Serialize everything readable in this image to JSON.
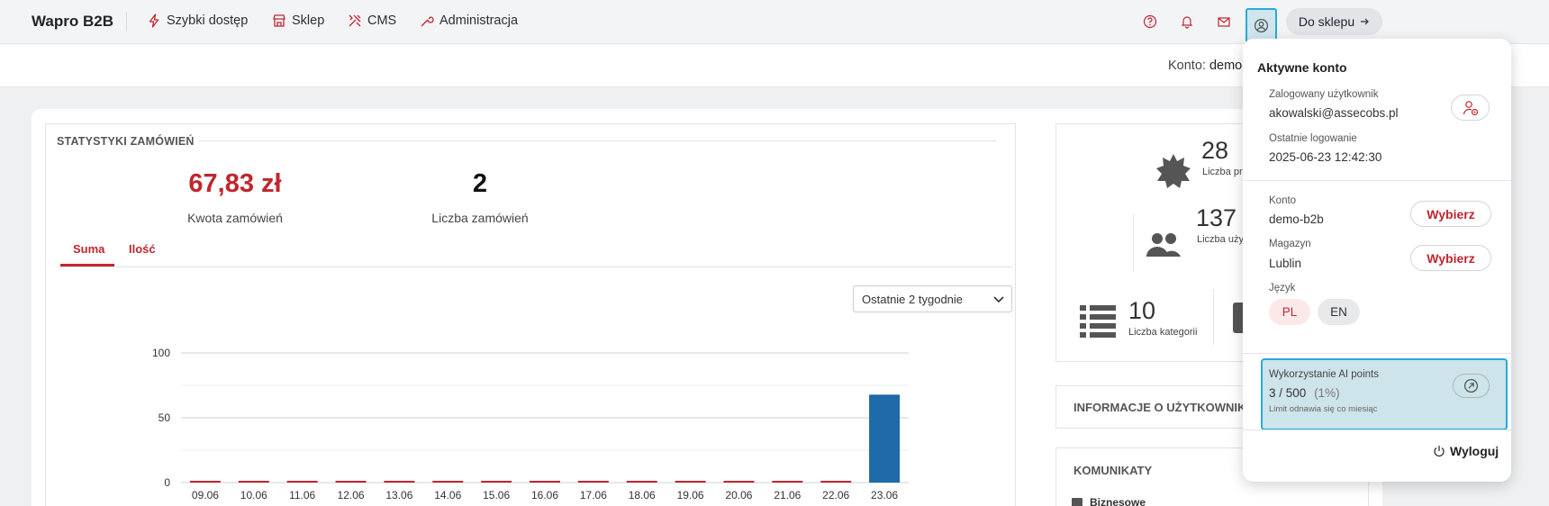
{
  "topbar": {
    "brand": "Wapro B2B",
    "nav": [
      {
        "label": "Szybki dostęp",
        "icon": "lightning-icon"
      },
      {
        "label": "Sklep",
        "icon": "store-icon"
      },
      {
        "label": "CMS",
        "icon": "tools-icon"
      },
      {
        "label": "Administracja",
        "icon": "wrench-icon"
      }
    ],
    "icons": [
      "help-icon",
      "bell-icon",
      "mail-icon",
      "user-icon"
    ],
    "shop_button": "Do sklepu"
  },
  "subbar": {
    "account_prefix": "Konto:",
    "account_value": "demo-"
  },
  "stats": {
    "title": "STATYSTYKI ZAMÓWIEŃ",
    "amount_value": "67,83 zł",
    "amount_label": "Kwota zamówień",
    "count_value": "2",
    "count_label": "Liczba zamówień",
    "tabs": [
      "Suma",
      "Ilość"
    ],
    "period_select": "Ostatnie 2 tygodnie"
  },
  "chart_data": {
    "type": "bar",
    "categories": [
      "09.06",
      "10.06",
      "11.06",
      "12.06",
      "13.06",
      "14.06",
      "15.06",
      "16.06",
      "17.06",
      "18.06",
      "19.06",
      "20.06",
      "21.06",
      "22.06",
      "23.06"
    ],
    "values": [
      0,
      0,
      0,
      0,
      0,
      0,
      0,
      0,
      0,
      0,
      0,
      0,
      0,
      0,
      67.83
    ],
    "yticks": [
      0,
      50,
      100
    ],
    "ylim": [
      0,
      100
    ],
    "grid": true,
    "colors": {
      "bar": "#1f6aa8",
      "zero_line": "#c0262f"
    }
  },
  "right_panel": {
    "stats": [
      {
        "value": "28",
        "label": "Liczba pro",
        "icon": "badge-icon"
      },
      {
        "value": "137",
        "label": "Liczba uży",
        "icon": "users-icon"
      },
      {
        "value": "10",
        "label": "Liczba kategorii",
        "icon": "list-icon"
      }
    ],
    "user_info_title": "INFORMACJE O UŻYTKOWNIKU",
    "messages_title": "KOMUNIKATY",
    "messages_first": "Biznesowe"
  },
  "dropdown": {
    "title": "Aktywne konto",
    "logged_user_label": "Zalogowany użytkownik",
    "logged_user_value": "akowalski@assecobs.pl",
    "last_login_label": "Ostatnie logowanie",
    "last_login_value": "2025-06-23 12:42:30",
    "account_label": "Konto",
    "account_value": "demo-b2b",
    "warehouse_label": "Magazyn",
    "warehouse_value": "Lublin",
    "choose_label": "Wybierz",
    "language_label": "Język",
    "languages": [
      "PL",
      "EN"
    ],
    "ai_title": "Wykorzystanie AI points",
    "ai_value": "3 / 500",
    "ai_percent": "(1%)",
    "ai_note": "Limit odnawia się co miesiąc",
    "logout_label": "Wyloguj"
  },
  "colors": {
    "accent": "#c0262f",
    "highlight": "#2aa9d8"
  }
}
